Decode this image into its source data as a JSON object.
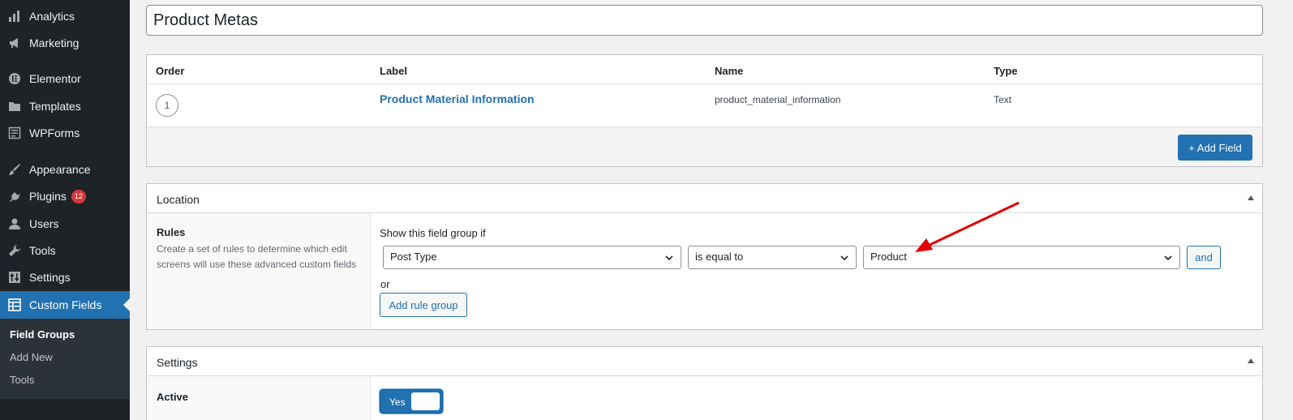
{
  "sidebar": {
    "items": [
      {
        "id": "analytics",
        "label": "Analytics",
        "icon": "bar-chart-icon"
      },
      {
        "id": "marketing",
        "label": "Marketing",
        "icon": "megaphone-icon"
      },
      {
        "id": "elementor",
        "label": "Elementor",
        "icon": "elementor-icon"
      },
      {
        "id": "templates",
        "label": "Templates",
        "icon": "folder-icon"
      },
      {
        "id": "wpforms",
        "label": "WPForms",
        "icon": "form-icon"
      },
      {
        "id": "appearance",
        "label": "Appearance",
        "icon": "paintbrush-icon"
      },
      {
        "id": "plugins",
        "label": "Plugins",
        "icon": "plug-icon",
        "badge": "12"
      },
      {
        "id": "users",
        "label": "Users",
        "icon": "user-icon"
      },
      {
        "id": "tools",
        "label": "Tools",
        "icon": "wrench-icon"
      },
      {
        "id": "settings",
        "label": "Settings",
        "icon": "sliders-icon"
      },
      {
        "id": "custom-fields",
        "label": "Custom Fields",
        "icon": "table-icon",
        "active": true
      }
    ],
    "submenu": [
      {
        "label": "Field Groups",
        "current": true
      },
      {
        "label": "Add New"
      },
      {
        "label": "Tools"
      }
    ]
  },
  "title_input": {
    "value": "Product Metas"
  },
  "fields_table": {
    "headers": {
      "order": "Order",
      "label": "Label",
      "name": "Name",
      "type": "Type"
    },
    "rows": [
      {
        "order": "1",
        "label": "Product Material Information",
        "name": "product_material_information",
        "type": "Text"
      }
    ],
    "add_field_label": "+ Add Field"
  },
  "location": {
    "title": "Location",
    "rules_title": "Rules",
    "rules_desc": "Create a set of rules to determine which edit screens will use these advanced custom fields",
    "show_if": "Show this field group if",
    "param": "Post Type",
    "operator": "is equal to",
    "value": "Product",
    "and_label": "and",
    "or_label": "or",
    "add_rule_group_label": "Add rule group"
  },
  "settings": {
    "title": "Settings",
    "active_label": "Active",
    "active_toggle": "Yes"
  },
  "colors": {
    "accent": "#2271b1",
    "sidebar_bg": "#1d2327",
    "annotation_arrow": "#e00000"
  }
}
